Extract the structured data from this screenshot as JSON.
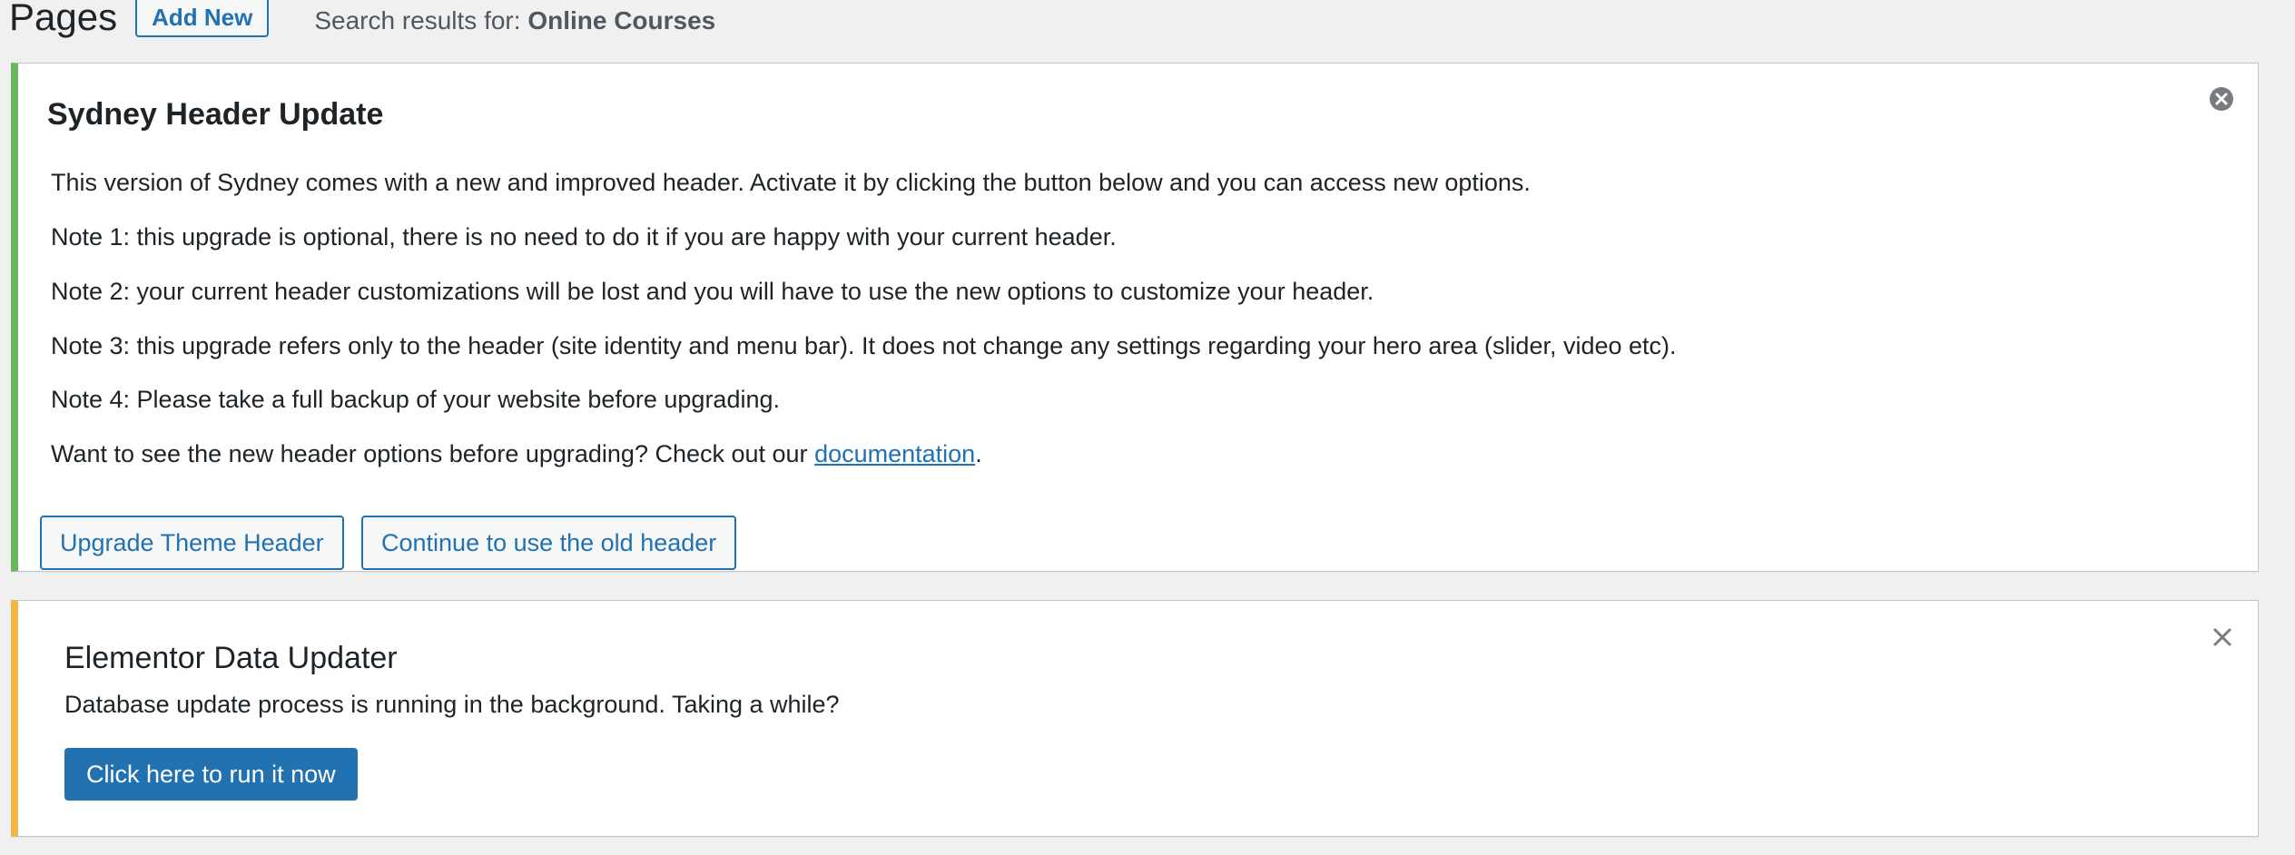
{
  "header": {
    "title": "Pages",
    "add_new_label": "Add New",
    "search_prefix": "Search results for: ",
    "search_term": "Online Courses"
  },
  "sydney_notice": {
    "title": "Sydney Header Update",
    "paragraphs": [
      "This version of Sydney comes with a new and improved header. Activate it by clicking the button below and you can access new options.",
      "Note 1: this upgrade is optional, there is no need to do it if you are happy with your current header.",
      "Note 2: your current header customizations will be lost and you will have to use the new options to customize your header.",
      "Note 3: this upgrade refers only to the header (site identity and menu bar). It does not change any settings regarding your hero area (slider, video etc).",
      "Note 4: Please take a full backup of your website before upgrading."
    ],
    "docs_prefix": "Want to see the new header options before upgrading? Check out our ",
    "docs_link": "documentation",
    "docs_suffix": ".",
    "upgrade_button": "Upgrade Theme Header",
    "continue_button": "Continue to use the old header",
    "accent_color": "#68b95b",
    "dismiss_icon": "circle-x-icon"
  },
  "elementor_notice": {
    "title": "Elementor Data Updater",
    "message": "Database update process is running in the background. Taking a while?",
    "run_button": "Click here to run it now",
    "accent_color": "#f0b849",
    "dismiss_icon": "close-icon"
  },
  "colors": {
    "primary": "#2271b1",
    "background": "#f0f0f1"
  }
}
